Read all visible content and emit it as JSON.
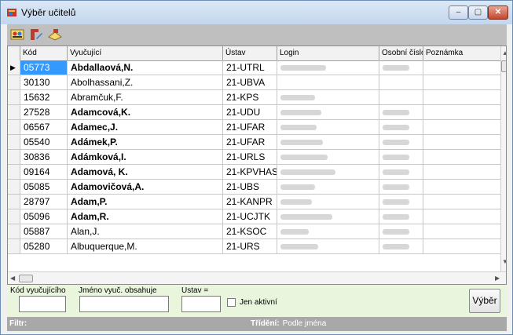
{
  "window": {
    "title": "Výběr učitelů",
    "accent": "#3399ff",
    "buttons": {
      "minimize": "–",
      "maximize": "▢",
      "close": "✕"
    }
  },
  "toolbar": {
    "icons": [
      "teachers-filter-icon",
      "teacher-edit-icon",
      "teacher-export-icon"
    ]
  },
  "grid": {
    "columns": [
      "Kód",
      "Vyučující",
      "Ústav",
      "Login",
      "Osobní číslo",
      "Poznámka"
    ],
    "rows": [
      {
        "kod": "05773",
        "vyucujici": "Abdallaová,N.",
        "ustav": "21-UTRL",
        "bold": true,
        "selected": true
      },
      {
        "kod": "30130",
        "vyucujici": "Abolhassani,Z.",
        "ustav": "21-UBVA",
        "bold": false
      },
      {
        "kod": "15632",
        "vyucujici": "Abramčuk,F.",
        "ustav": "21-KPS",
        "bold": false
      },
      {
        "kod": "27528",
        "vyucujici": "Adamcová,K.",
        "ustav": "21-UDU",
        "bold": true
      },
      {
        "kod": "06567",
        "vyucujici": "Adamec,J.",
        "ustav": "21-UFAR",
        "bold": true
      },
      {
        "kod": "05540",
        "vyucujici": "Adámek,P.",
        "ustav": "21-UFAR",
        "bold": true
      },
      {
        "kod": "30836",
        "vyucujici": "Adámková,I.",
        "ustav": "21-URLS",
        "bold": true
      },
      {
        "kod": "09164",
        "vyucujici": "Adamová, K.",
        "ustav": "21-KPVHAS",
        "bold": true
      },
      {
        "kod": "05085",
        "vyucujici": "Adamovičová,A.",
        "ustav": "21-UBS",
        "bold": true
      },
      {
        "kod": "28797",
        "vyucujici": "Adam,P.",
        "ustav": "21-KANPR",
        "bold": true
      },
      {
        "kod": "05096",
        "vyucujici": "Adam,R.",
        "ustav": "21-UCJTK",
        "bold": true
      },
      {
        "kod": "05887",
        "vyucujici": "Alan,J.",
        "ustav": "21-KSOC",
        "bold": false
      },
      {
        "kod": "05280",
        "vyucujici": "Albuquerque,M.",
        "ustav": "21-URS",
        "bold": false
      }
    ]
  },
  "filter": {
    "kod_label": "Kód vyučujícího",
    "jmeno_label": "Jméno vyuč. obsahuje",
    "ustav_label": "Ustav =",
    "kod_value": "",
    "jmeno_value": "",
    "ustav_value": "",
    "jen_aktivni_label": "Jen aktivní",
    "vyber_label": "Výběr"
  },
  "status": {
    "filtr_label": "Filtr:",
    "trideni_label": "Třídění:",
    "trideni_value": "Podle jména"
  }
}
